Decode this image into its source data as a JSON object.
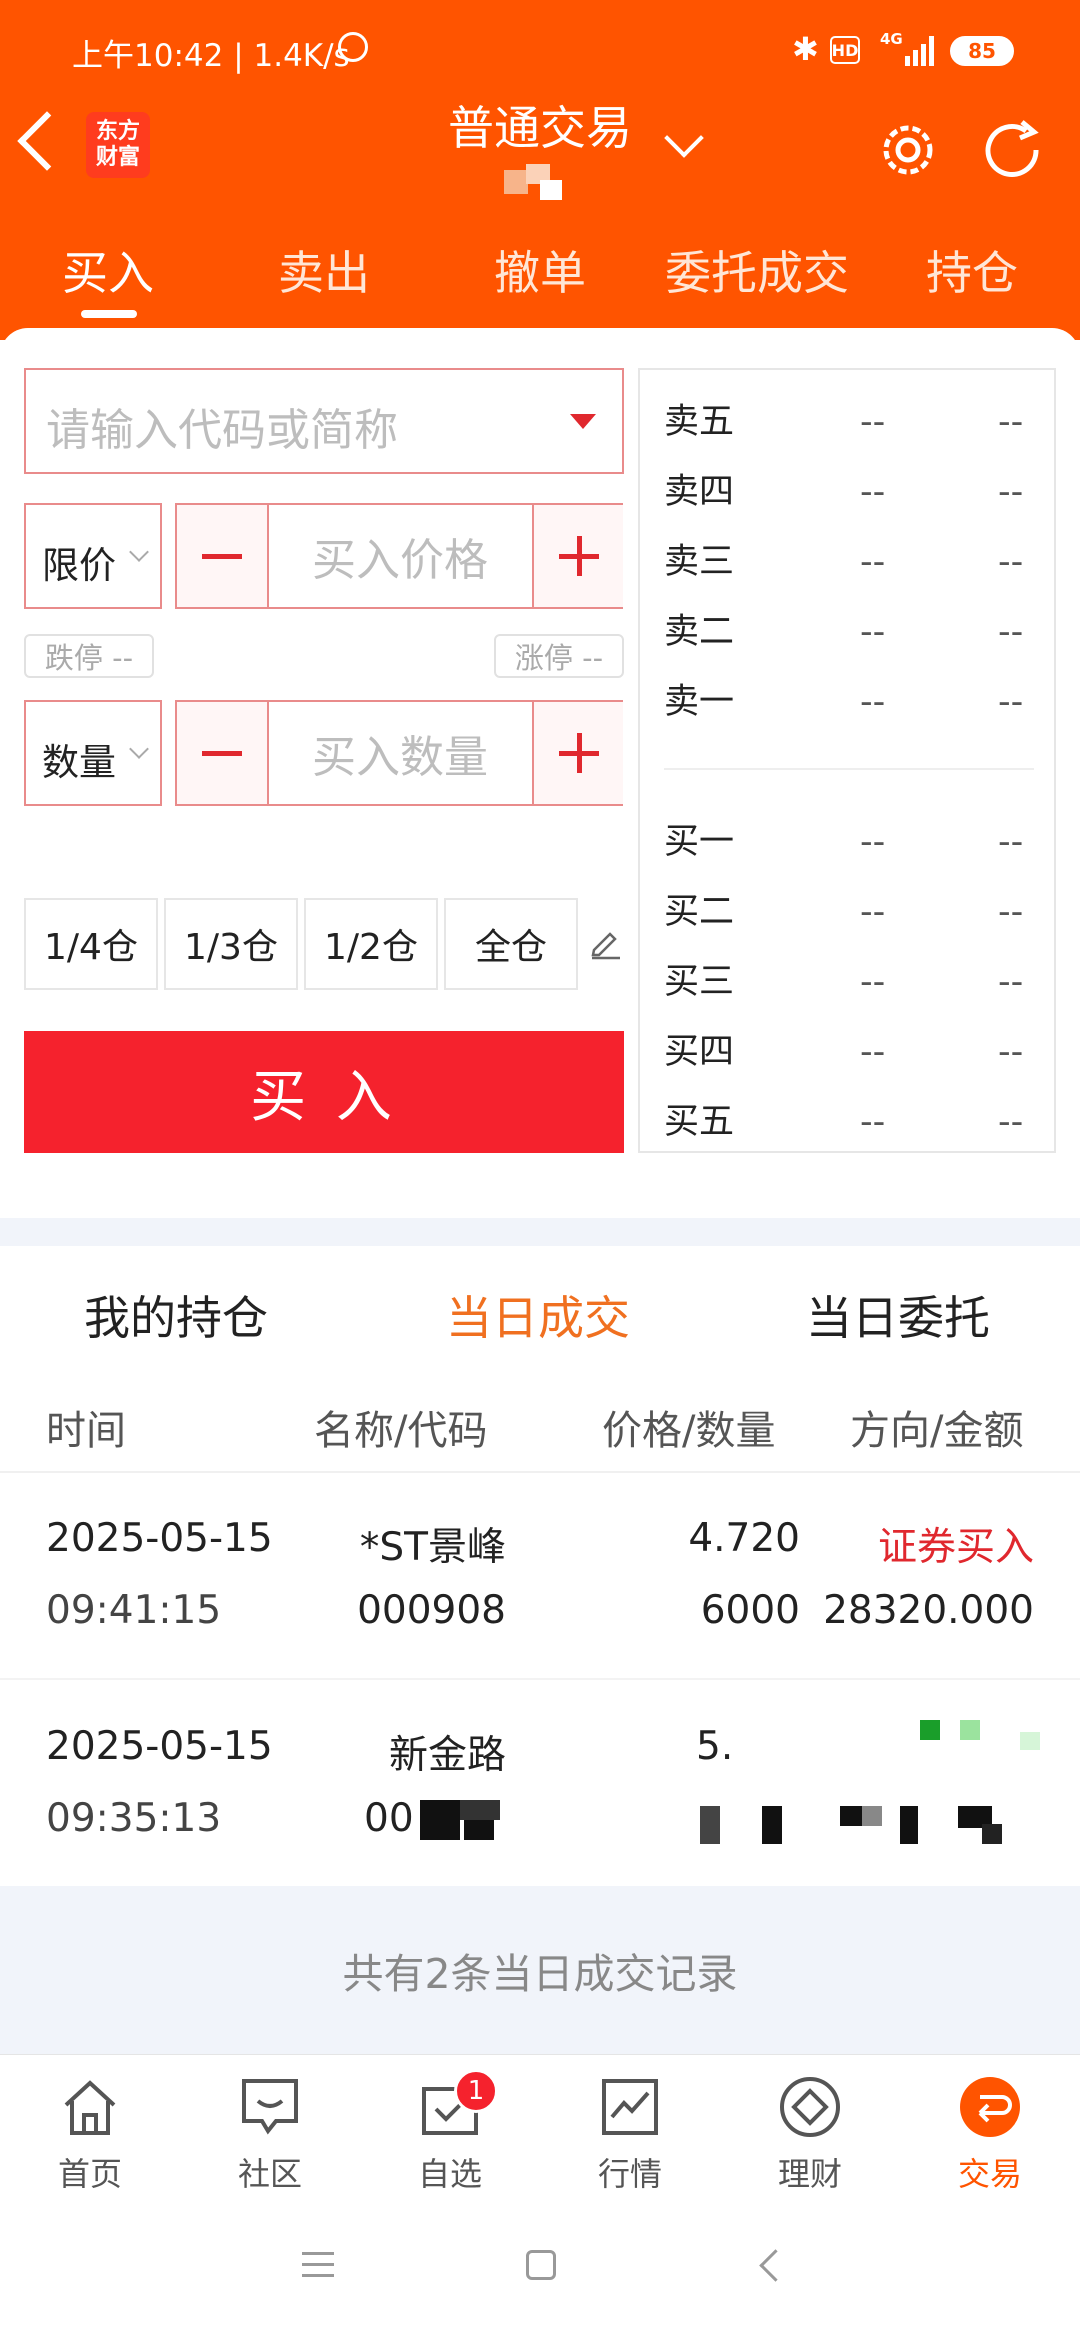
{
  "status": {
    "time_speed": "上午10:42 | 1.4K/s",
    "network": "4G",
    "battery": "85"
  },
  "header": {
    "logo_line1": "东方",
    "logo_line2": "财富",
    "title": "普通交易"
  },
  "tabs": [
    {
      "label": "买入"
    },
    {
      "label": "卖出"
    },
    {
      "label": "撤单"
    },
    {
      "label": "委托成交"
    },
    {
      "label": "持仓"
    }
  ],
  "form": {
    "code_placeholder": "请输入代码或简称",
    "price_type": "限价",
    "price_placeholder": "买入价格",
    "limit_down": "跌停 --",
    "limit_up": "涨停 --",
    "qty_type": "数量",
    "qty_placeholder": "买入数量",
    "positions": [
      "1/4仓",
      "1/3仓",
      "1/2仓",
      "全仓"
    ],
    "buy_button": "买 入"
  },
  "orderbook": {
    "sell": [
      {
        "label": "卖五",
        "price": "--",
        "vol": "--"
      },
      {
        "label": "卖四",
        "price": "--",
        "vol": "--"
      },
      {
        "label": "卖三",
        "price": "--",
        "vol": "--"
      },
      {
        "label": "卖二",
        "price": "--",
        "vol": "--"
      },
      {
        "label": "卖一",
        "price": "--",
        "vol": "--"
      }
    ],
    "buy": [
      {
        "label": "买一",
        "price": "--",
        "vol": "--"
      },
      {
        "label": "买二",
        "price": "--",
        "vol": "--"
      },
      {
        "label": "买三",
        "price": "--",
        "vol": "--"
      },
      {
        "label": "买四",
        "price": "--",
        "vol": "--"
      },
      {
        "label": "买五",
        "price": "--",
        "vol": "--"
      }
    ]
  },
  "subtabs": [
    "我的持仓",
    "当日成交",
    "当日委托"
  ],
  "columns": [
    "时间",
    "名称/代码",
    "价格/数量",
    "方向/金额"
  ],
  "trades": [
    {
      "date": "2025-05-15",
      "time": "09:41:15",
      "name": "*ST景峰",
      "code": "000908",
      "price": "4.720",
      "qty": "6000",
      "direction": "证券买入",
      "amount": "28320.000"
    },
    {
      "date": "2025-05-15",
      "time": "09:35:13",
      "name": "新金路",
      "code": "00",
      "price": "5.",
      "qty": "",
      "direction": "",
      "amount": ""
    }
  ],
  "footer_note": "共有2条当日成交记录",
  "nav": [
    {
      "label": "首页"
    },
    {
      "label": "社区"
    },
    {
      "label": "自选",
      "badge": "1"
    },
    {
      "label": "行情"
    },
    {
      "label": "理财"
    },
    {
      "label": "交易"
    }
  ],
  "colors": {
    "brand": "#ff5400",
    "buy_red": "#f5222d",
    "active_orange": "#f07020",
    "direction_red": "#e0282e"
  }
}
